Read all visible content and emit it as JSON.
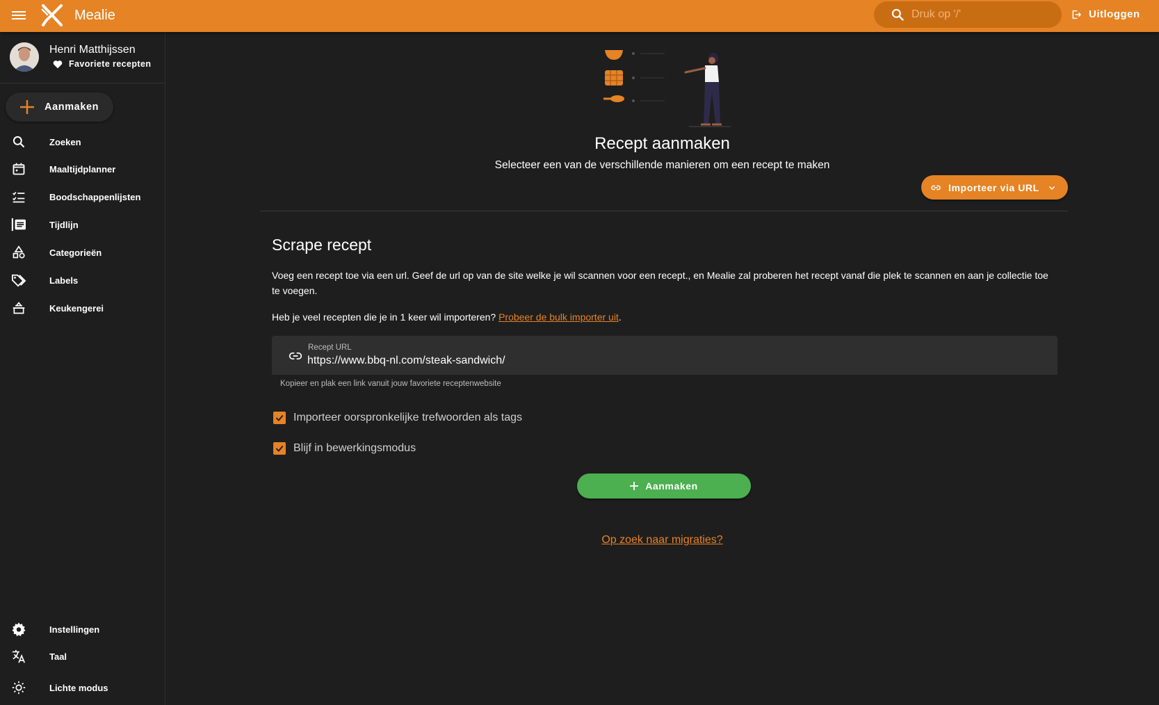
{
  "app": {
    "title": "Mealie",
    "accent": "#e58325"
  },
  "header": {
    "search_placeholder": "Druk op '/'",
    "logout_label": "Uitloggen"
  },
  "sidebar": {
    "user_name": "Henri Matthijssen",
    "favorites_label": "Favoriete recepten",
    "create_label": "Aanmaken",
    "items": [
      {
        "label": "Zoeken",
        "icon": "search-icon"
      },
      {
        "label": "Maaltijdplanner",
        "icon": "calendar-icon"
      },
      {
        "label": "Boodschappenlijsten",
        "icon": "checklist-icon"
      },
      {
        "label": "Tijdlijn",
        "icon": "timeline-icon"
      },
      {
        "label": "Categorieën",
        "icon": "shapes-icon"
      },
      {
        "label": "Labels",
        "icon": "tags-icon"
      },
      {
        "label": "Keukengerei",
        "icon": "pot-icon"
      }
    ],
    "bottom_items": [
      {
        "label": "Instellingen",
        "icon": "gear-icon"
      },
      {
        "label": "Taal",
        "icon": "translate-icon"
      },
      {
        "label": "Lichte modus",
        "icon": "sun-icon"
      }
    ]
  },
  "main": {
    "title": "Recept aanmaken",
    "subtitle": "Selecteer een van de verschillende manieren om een recept te maken",
    "import_button": "Importeer via URL",
    "section_title": "Scrape recept",
    "description": "Voeg een recept toe via een url. Geef de url op van de site welke je wil scannen voor een recept., en Mealie zal proberen het recept vanaf die plek te scannen en aan je collectie toe te voegen.",
    "bulk_text": "Heb je veel recepten die je in 1 keer wil importeren? ",
    "bulk_link": "Probeer de bulk importer uit",
    "bulk_end": ".",
    "url_label": "Recept URL",
    "url_value": "https://www.bbq-nl.com/steak-sandwich/",
    "url_hint": "Kopieer en plak een link vanuit jouw favoriete receptenwebsite",
    "checkbox_tags": "Importeer oorspronkelijke trefwoorden als tags",
    "checkbox_edit": "Blijf in bewerkingsmodus",
    "submit_label": "Aanmaken",
    "migrate_link": "Op zoek naar migraties?"
  }
}
